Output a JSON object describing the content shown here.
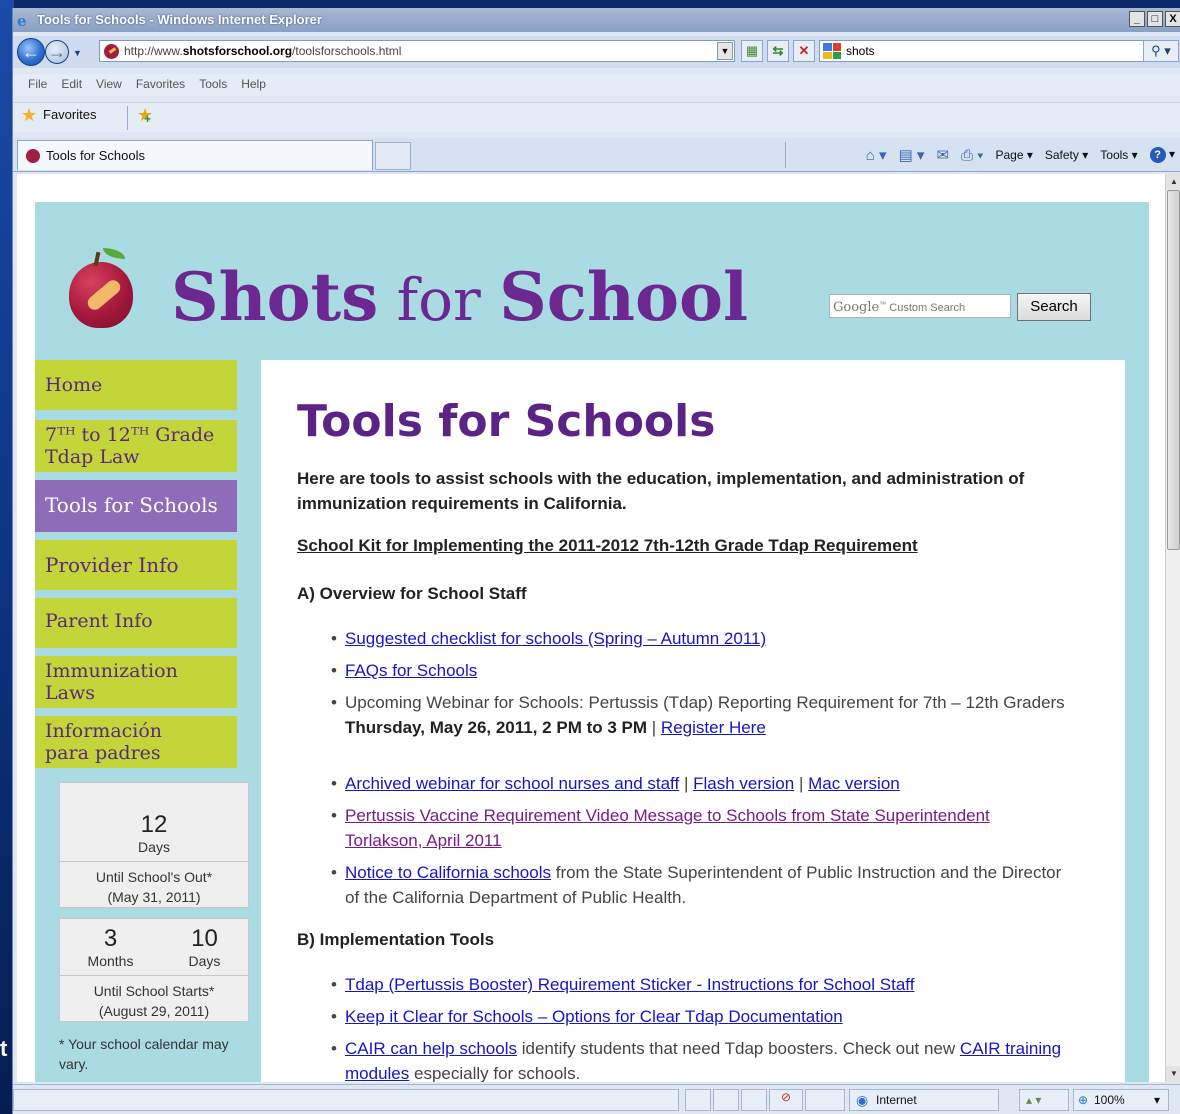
{
  "window": {
    "title": "Tools for Schools - Windows Internet Explorer",
    "min": "_",
    "max": "□",
    "close": "X"
  },
  "address": {
    "url_prefix": "http://www.",
    "url_domain": "shotsforschool.org",
    "url_path": "/toolsforschools.html",
    "search_value": "shots"
  },
  "menu": [
    "File",
    "Edit",
    "View",
    "Favorites",
    "Tools",
    "Help"
  ],
  "favorites_label": "Favorites",
  "tab": {
    "label": "Tools for Schools"
  },
  "command_bar": {
    "page": "Page ▾",
    "safety": "Safety ▾",
    "tools": "Tools ▾",
    "help": "?"
  },
  "site": {
    "logo_bold1": "Shots",
    "logo_light": "for",
    "logo_bold2": "School",
    "search_placeholder": "Custom Search",
    "google": "Google",
    "search_button": "Search"
  },
  "sidebar": {
    "items": [
      {
        "line1": "Home",
        "line2": ""
      },
      {
        "line1": "7ᵀᴴ to 12ᵀᴴ Grade",
        "line2": "Tdap Law"
      },
      {
        "line1": "Tools for Schools",
        "line2": ""
      },
      {
        "line1": "Provider Info",
        "line2": ""
      },
      {
        "line1": "Parent Info",
        "line2": ""
      },
      {
        "line1": "Immunization",
        "line2": "Laws"
      },
      {
        "line1": "Información",
        "line2": "para padres"
      }
    ],
    "countdown1": {
      "num": "12",
      "unit": "Days",
      "until1": "Until School's Out*",
      "until2": "(May 31, 2011)"
    },
    "countdown2": {
      "num1": "3",
      "unit1": "Months",
      "num2": "10",
      "unit2": "Days",
      "until1": "Until School Starts*",
      "until2": "(August 29, 2011)"
    },
    "note": "* Your school calendar may vary."
  },
  "content": {
    "title": "Tools for Schools",
    "intro": "Here are tools to assist schools with the education, implementation, and administration of immunization requirements in California.",
    "kit": "School Kit for Implementing the 2011-2012 7th-12th Grade Tdap Requirement",
    "sectionA": "A) Overview for School Staff",
    "a1": "Suggested checklist for schools (Spring – Autumn 2011)",
    "a2": "FAQs for Schools",
    "a3_text": "Upcoming Webinar for Schools: Pertussis (Tdap) Reporting Requirement for 7th – 12th Graders",
    "a3_date": "Thursday, May 26, 2011, 2 PM to 3 PM",
    "a3_link": "Register Here",
    "a4_link1": "Archived webinar for school nurses and staff",
    "a4_link2": "Flash version",
    "a4_link3": "Mac version",
    "a5": "Pertussis Vaccine Requirement Video Message to Schools from State Superintendent Torlakson, April 2011",
    "a6_link": "Notice to California schools",
    "a6_text": "from the State Superintendent of Public Instruction and the Director of the California Department of Public Health.",
    "sectionB": "B) Implementation Tools",
    "b1": "Tdap (Pertussis Booster) Requirement Sticker - Instructions for School Staff",
    "b2": "Keep it Clear for Schools – Options for Clear Tdap Documentation",
    "b3_link1": "CAIR can help schools",
    "b3_text": "identify students that need Tdap boosters. Check out new",
    "b3_link2": "CAIR training modules",
    "b3_text2": "especially for schools."
  },
  "status": {
    "zone": "Internet",
    "zoom": "100%"
  }
}
